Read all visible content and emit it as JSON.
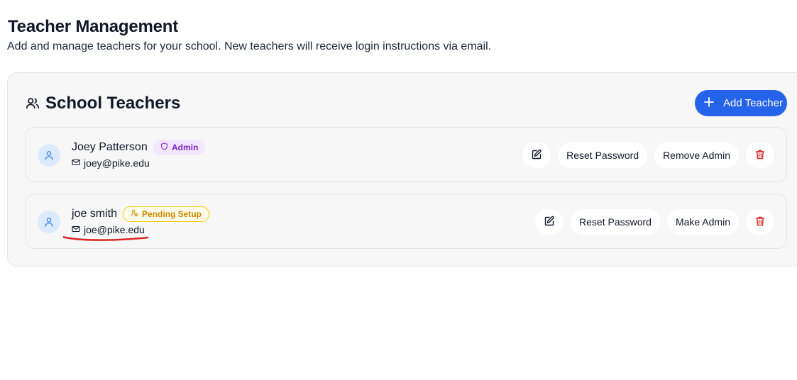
{
  "header": {
    "title": "Teacher Management",
    "subtitle": "Add and manage teachers for your school. New teachers will receive login instructions via email."
  },
  "card": {
    "title": "School Teachers",
    "title_icon": "users-icon",
    "add_button_label": "Add Teacher",
    "add_button_icon": "plus-icon"
  },
  "teachers": [
    {
      "name": "Joey Patterson",
      "badge": "Admin",
      "badge_icon": "shield-icon",
      "email": "joey@pike.edu",
      "actions": {
        "edit_icon": "edit-icon",
        "reset": "Reset Password",
        "role": "Remove Admin",
        "delete_icon": "trash-icon"
      }
    },
    {
      "name": "joe smith",
      "badge": "Pending Setup",
      "badge_icon": "user-clock-icon",
      "email": "joe@pike.edu",
      "actions": {
        "edit_icon": "edit-icon",
        "reset": "Reset Password",
        "role": "Make Admin",
        "delete_icon": "trash-icon"
      }
    }
  ],
  "colors": {
    "accent": "#2563eb",
    "admin_badge_bg": "#f3e8ff",
    "admin_badge_text": "#7e22ce",
    "pending_badge_bg": "#fefce8",
    "pending_badge_text": "#ca8a04",
    "delete": "#dc2626",
    "annotation": "#dc2626"
  }
}
